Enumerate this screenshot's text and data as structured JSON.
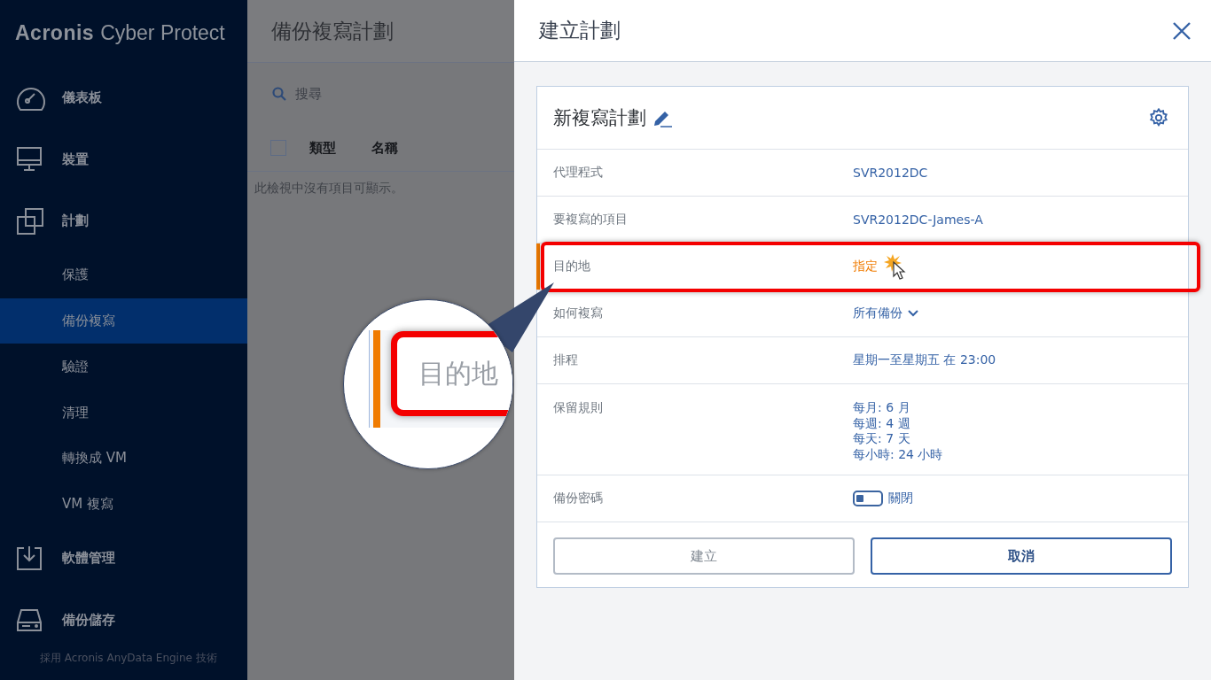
{
  "brand": {
    "name": "Acronis",
    "product": "Cyber Protect"
  },
  "sidebar": {
    "items": [
      {
        "label": "儀表板",
        "kind": "main",
        "selected": false
      },
      {
        "label": "裝置",
        "kind": "main",
        "selected": false
      },
      {
        "label": "計劃",
        "kind": "main",
        "selected": false
      },
      {
        "label": "保護",
        "kind": "sub",
        "selected": false
      },
      {
        "label": "備份複寫",
        "kind": "sub",
        "selected": true
      },
      {
        "label": "驗證",
        "kind": "sub",
        "selected": false
      },
      {
        "label": "清理",
        "kind": "sub",
        "selected": false
      },
      {
        "label": "轉換成 VM",
        "kind": "sub",
        "selected": false
      },
      {
        "label": "VM 複寫",
        "kind": "sub",
        "selected": false
      },
      {
        "label": "軟體管理",
        "kind": "main",
        "selected": false
      },
      {
        "label": "備份儲存",
        "kind": "main",
        "selected": false
      }
    ],
    "footer": "採用 Acronis AnyData Engine 技術"
  },
  "list_page": {
    "title": "備份複寫計劃",
    "search": {
      "placeholder": "搜尋"
    },
    "select_all": {
      "checked": false
    },
    "columns": [
      "類型",
      "名稱"
    ],
    "empty_message": "此檢視中沒有項目可顯示。"
  },
  "panel": {
    "title": "建立計劃",
    "plan_name": "新複寫計劃",
    "rows": [
      {
        "kind": "link",
        "label": "代理程式",
        "value": "SVR2012DC",
        "highlighted": false
      },
      {
        "kind": "link",
        "label": "要複寫的項目",
        "value": "SVR2012DC-James-A",
        "highlighted": false
      },
      {
        "kind": "required",
        "label": "目的地",
        "value": "指定",
        "highlighted": true
      },
      {
        "kind": "dropdown",
        "label": "如何複寫",
        "value": "所有備份",
        "highlighted": false
      },
      {
        "kind": "link",
        "label": "排程",
        "value": "星期一至星期五 在 23:00",
        "highlighted": false
      },
      {
        "kind": "lines",
        "label": "保留規則",
        "lines": [
          "每月: 6 月",
          "每週: 4 週",
          "每天: 7 天",
          "每小時: 24 小時"
        ],
        "highlighted": false
      },
      {
        "kind": "toggle",
        "label": "備份密碼",
        "on": false,
        "value": "關閉",
        "highlighted": false
      }
    ],
    "buttons": [
      {
        "label": "建立",
        "disabled": true
      },
      {
        "label": "取消",
        "disabled": false
      }
    ]
  },
  "magnifier": {
    "label": "目的地"
  }
}
